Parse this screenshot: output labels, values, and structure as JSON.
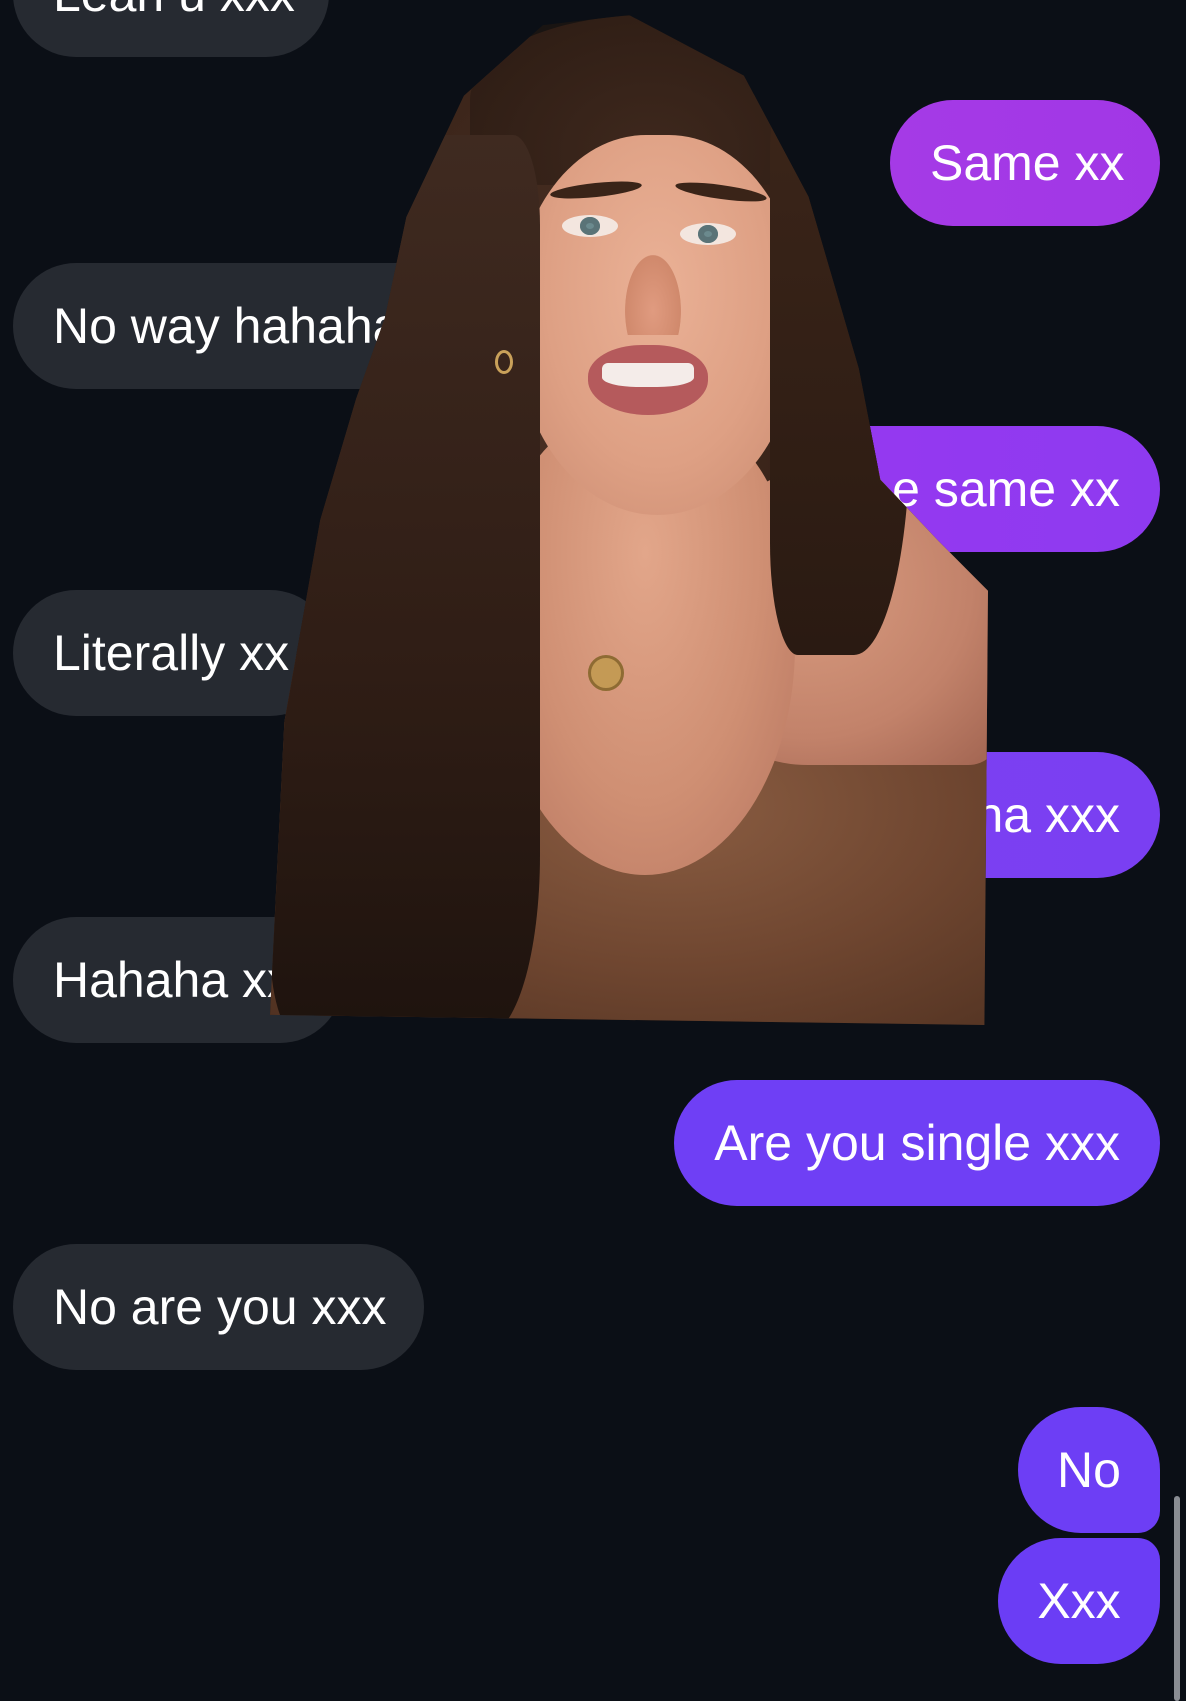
{
  "messages": [
    {
      "id": "b1",
      "side": "received",
      "text": "Lean u xxx"
    },
    {
      "id": "b2",
      "side": "sent",
      "text": "Same xx"
    },
    {
      "id": "b3",
      "side": "received",
      "text": "No way hahaha x"
    },
    {
      "id": "b4",
      "side": "sent",
      "text": "e same xx"
    },
    {
      "id": "b5",
      "side": "received",
      "text": "Literally xx"
    },
    {
      "id": "b6",
      "side": "sent",
      "text": "ha xxx"
    },
    {
      "id": "b7",
      "side": "received",
      "text": "Hahaha xx"
    },
    {
      "id": "b8",
      "side": "sent",
      "text": "Are you single xxx"
    },
    {
      "id": "b9",
      "side": "received",
      "text": "No are you xxx"
    },
    {
      "id": "b10",
      "side": "sent",
      "text": "No"
    },
    {
      "id": "b11",
      "side": "sent",
      "text": "Xxx"
    }
  ],
  "colors": {
    "background": "#0b0f16",
    "received_bubble": "#262a31",
    "sent_bubble_top": "#a53ae6",
    "sent_bubble_bottom": "#6b3df5",
    "text": "#ffffff"
  },
  "overlay": {
    "icon": "person-photo"
  }
}
